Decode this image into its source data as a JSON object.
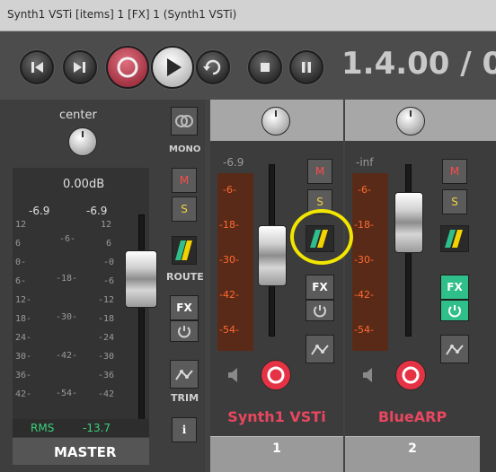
{
  "window": {
    "title": "Synth1 VSTi [items] 1 [FX] 1 (Synth1 VSTi)"
  },
  "transport": {
    "time": "1.4.00 / 0"
  },
  "master": {
    "pan_label": "center",
    "db_label": "0.00dB",
    "peak_left": "-6.9",
    "peak_right": "-6.9",
    "scale_left": [
      "12",
      "6",
      "0-",
      "6-",
      "12-",
      "18-",
      "24-",
      "30-",
      "36-",
      "42-"
    ],
    "scale_mid": [
      "-6-",
      "-18-",
      "-30-",
      "-42-",
      "-54-"
    ],
    "scale_right": [
      "12",
      "6",
      "-0",
      "-6",
      "-12",
      "-18",
      "-24",
      "-30",
      "-36",
      "-42"
    ],
    "rms_label": "RMS",
    "rms_value": "-13.7",
    "name": "MASTER"
  },
  "master_controls": {
    "mono_label": "MONO",
    "mute_label": "M",
    "solo_label": "S",
    "route_label": "ROUTE",
    "fx_label": "FX",
    "trim_label": "TRIM",
    "info_label": "i"
  },
  "tracks": [
    {
      "peak": "-6.9",
      "meter_labels": [
        "-6-",
        "-18-",
        "-30-",
        "-42-",
        "-54-"
      ],
      "mute_label": "M",
      "solo_label": "S",
      "fx_label": "FX",
      "name": "Synth1 VSTi",
      "number": "1",
      "fx_active": false
    },
    {
      "peak": "-inf",
      "meter_labels": [
        "-6-",
        "-18-",
        "-30-",
        "-42-",
        "-54-"
      ],
      "mute_label": "M",
      "solo_label": "S",
      "fx_label": "FX",
      "name": "BlueARP",
      "number": "2",
      "fx_active": true
    }
  ],
  "colors": {
    "track_name": "#e8475f",
    "meter_text": "#ff6a30",
    "rms_text": "#3ad07a",
    "fx_active": "#2fbf8a",
    "highlight_circle": "#f2e600"
  }
}
